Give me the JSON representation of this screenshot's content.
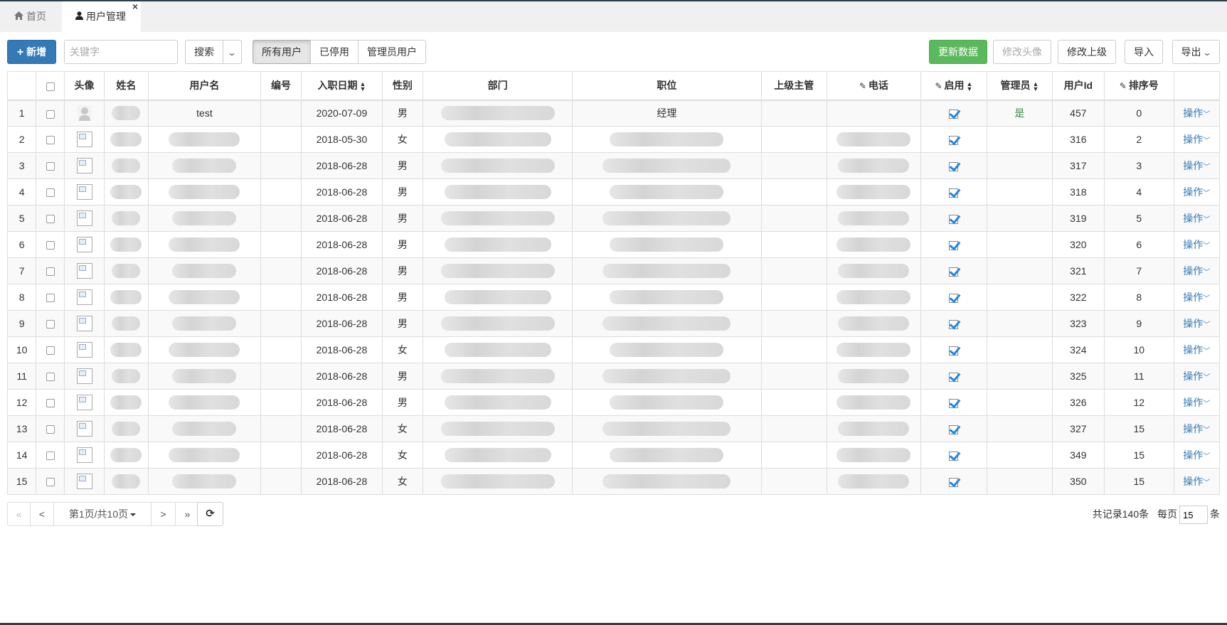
{
  "tabs": [
    {
      "label": "首页",
      "icon": "home-icon"
    },
    {
      "label": "用户管理",
      "icon": "user-icon",
      "close": "×"
    }
  ],
  "toolbar": {
    "add_label": "新增",
    "search_placeholder": "关键字",
    "search_label": "搜索",
    "filters": [
      "所有用户",
      "已停用",
      "管理员用户"
    ],
    "refresh_data_label": "更新数据",
    "change_avatar_label": "修改头像",
    "change_superior_label": "修改上级",
    "import_label": "导入",
    "export_label": "导出"
  },
  "table": {
    "columns": [
      "头像",
      "姓名",
      "用户名",
      "编号",
      "入职日期",
      "性别",
      "部门",
      "职位",
      "上级主管",
      "电话",
      "启用",
      "管理员",
      "用户Id",
      "排序号"
    ],
    "rows": [
      {
        "no": "1",
        "username": "test",
        "date": "2020-07-09",
        "gender": "男",
        "position": "经理",
        "admin": "是",
        "id": "457",
        "sort": "0"
      },
      {
        "no": "2",
        "username": "",
        "date": "2018-05-30",
        "gender": "女",
        "position": "",
        "admin": "",
        "id": "316",
        "sort": "2"
      },
      {
        "no": "3",
        "username": "",
        "date": "2018-06-28",
        "gender": "男",
        "position": "",
        "admin": "",
        "id": "317",
        "sort": "3"
      },
      {
        "no": "4",
        "username": "",
        "date": "2018-06-28",
        "gender": "男",
        "position": "",
        "admin": "",
        "id": "318",
        "sort": "4"
      },
      {
        "no": "5",
        "username": "",
        "date": "2018-06-28",
        "gender": "男",
        "position": "",
        "admin": "",
        "id": "319",
        "sort": "5"
      },
      {
        "no": "6",
        "username": "",
        "date": "2018-06-28",
        "gender": "男",
        "position": "",
        "admin": "",
        "id": "320",
        "sort": "6"
      },
      {
        "no": "7",
        "username": "",
        "date": "2018-06-28",
        "gender": "男",
        "position": "",
        "admin": "",
        "id": "321",
        "sort": "7"
      },
      {
        "no": "8",
        "username": "",
        "date": "2018-06-28",
        "gender": "男",
        "position": "",
        "admin": "",
        "id": "322",
        "sort": "8"
      },
      {
        "no": "9",
        "username": "",
        "date": "2018-06-28",
        "gender": "男",
        "position": "",
        "admin": "",
        "id": "323",
        "sort": "9"
      },
      {
        "no": "10",
        "username": "",
        "date": "2018-06-28",
        "gender": "女",
        "position": "",
        "admin": "",
        "id": "324",
        "sort": "10"
      },
      {
        "no": "11",
        "username": "",
        "date": "2018-06-28",
        "gender": "男",
        "position": "",
        "admin": "",
        "id": "325",
        "sort": "11"
      },
      {
        "no": "12",
        "username": "",
        "date": "2018-06-28",
        "gender": "男",
        "position": "",
        "admin": "",
        "id": "326",
        "sort": "12"
      },
      {
        "no": "13",
        "username": "",
        "date": "2018-06-28",
        "gender": "女",
        "position": "",
        "admin": "",
        "id": "327",
        "sort": "15"
      },
      {
        "no": "14",
        "username": "",
        "date": "2018-06-28",
        "gender": "女",
        "position": "",
        "admin": "",
        "id": "349",
        "sort": "15"
      },
      {
        "no": "15",
        "username": "",
        "date": "2018-06-28",
        "gender": "女",
        "position": "",
        "admin": "",
        "id": "350",
        "sort": "15"
      }
    ],
    "action_label": "操作"
  },
  "pager": {
    "first": "«",
    "prev": "<",
    "page_label": "第1页/共10页",
    "next": ">",
    "last": "»",
    "total_label": "共记录140条",
    "per_page_label": "每页",
    "per_page_value": "15",
    "per_page_unit": "条"
  },
  "colors": {
    "primary": "#337ab7",
    "success": "#5cb85c",
    "check": "#1e88e5"
  }
}
